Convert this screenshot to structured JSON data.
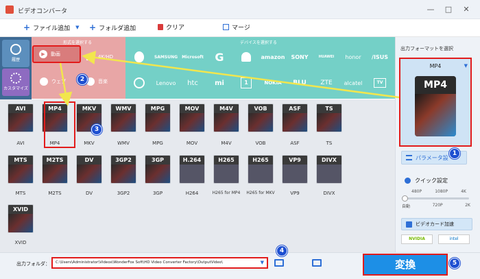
{
  "window": {
    "title": "ビデオコンバータ",
    "minimize": "—",
    "maximize": "□",
    "close": "✕"
  },
  "toolbar": {
    "add_files": "ファイル追加",
    "add_folder": "フォルダ追加",
    "clear": "クリア",
    "merge": "マージ"
  },
  "left": {
    "recent": "履歴",
    "custom": "カスタマイズ"
  },
  "categories": {
    "format_header": "形式を選択する",
    "device_header": "デバイスを選択する",
    "video": "動画",
    "hd": "4K/HD",
    "web": "ウェブ",
    "audio": "音楽"
  },
  "brands_row1": [
    "",
    "SAMSUNG",
    "Microsoft",
    "G",
    "",
    "amazon",
    "SONY",
    "HUAWEI",
    "honor",
    "/ISUS"
  ],
  "brands_row2": [
    "",
    "Lenovo",
    "htc",
    "mi",
    "1",
    "NOKIA",
    "BLU",
    "ZTE",
    "alcatel",
    "TV"
  ],
  "formats_row1": [
    {
      "band": "AVI",
      "label": "AVI"
    },
    {
      "band": "MP4",
      "label": "MP4"
    },
    {
      "band": "MKV",
      "label": "MKV"
    },
    {
      "band": "WMV",
      "label": "WMV"
    },
    {
      "band": "MPG",
      "label": "MPG"
    },
    {
      "band": "MOV",
      "label": "MOV"
    },
    {
      "band": "M4V",
      "label": "M4V"
    },
    {
      "band": "VOB",
      "label": "VOB"
    },
    {
      "band": "ASF",
      "label": "ASF"
    },
    {
      "band": "TS",
      "label": "TS"
    }
  ],
  "formats_row2": [
    {
      "band": "MTS",
      "label": "MTS"
    },
    {
      "band": "M2TS",
      "label": "M2TS"
    },
    {
      "band": "DV",
      "label": "DV"
    },
    {
      "band": "3GP2",
      "label": "3GP2"
    },
    {
      "band": "3GP",
      "label": "3GP"
    },
    {
      "band": "H.264",
      "label": "H264"
    },
    {
      "band": "H265",
      "label": "H265 for MP4"
    },
    {
      "band": "H265",
      "label": "H265 for MKV"
    },
    {
      "band": "VP9",
      "label": "VP9"
    },
    {
      "band": "DIVX",
      "label": "DIVX"
    }
  ],
  "formats_row3": [
    {
      "band": "XVID",
      "label": "XVID"
    }
  ],
  "right": {
    "output_format_label": "出力フォーマットを選択",
    "selected_format": "MP4",
    "preview_band": "MP4",
    "params_button": "パラメータ設",
    "quick_setting": "クイック設定",
    "quality_ticks": [
      "480P",
      "1080P",
      "4K"
    ],
    "quality_ticks2": [
      "自動",
      "720P",
      "2K"
    ],
    "gpu_accel": "ビデオカード加速",
    "gpu_brands": [
      "NVIDIA",
      "intel"
    ],
    "quality_fraction": 0.0
  },
  "bottom": {
    "output_folder_label": "出力フォルダ：",
    "output_path": "C:\\Users\\Administrator\\Videos\\WonderFox Soft\\HD Video Converter Factory\\OutputVideo\\",
    "convert_label": "変換"
  },
  "annotations": [
    "1",
    "2",
    "3",
    "4",
    "5"
  ],
  "colors": {
    "accent": "#1d8fe6",
    "annotation": "#e21b1b",
    "arrow": "#f2e64d",
    "badge": "#1d4fd1"
  }
}
